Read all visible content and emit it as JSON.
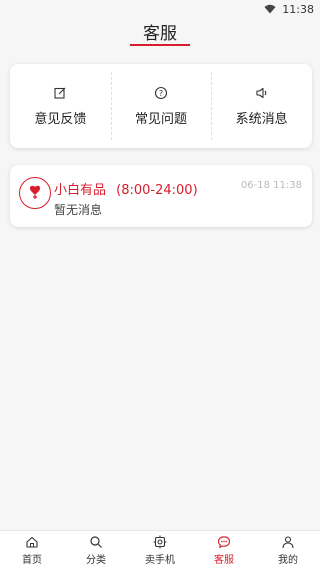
{
  "status": {
    "time": "11:38"
  },
  "header": {
    "title": "客服"
  },
  "entries": [
    {
      "label": "意见反馈",
      "icon": "edit-icon"
    },
    {
      "label": "常见问题",
      "icon": "question-circle-icon"
    },
    {
      "label": "系统消息",
      "icon": "speaker-icon"
    }
  ],
  "message": {
    "name": "小白有品",
    "hours": "(8:00-24:00)",
    "time": "06-18 11:38",
    "text": "暂无消息"
  },
  "tabbar": {
    "items": [
      {
        "label": "首页",
        "icon": "home-icon"
      },
      {
        "label": "分类",
        "icon": "search-icon"
      },
      {
        "label": "卖手机",
        "icon": "phone-sell-icon"
      },
      {
        "label": "客服",
        "icon": "chat-icon"
      },
      {
        "label": "我的",
        "icon": "user-icon"
      }
    ],
    "active_index": 3,
    "active_color": "#d81e2c"
  }
}
